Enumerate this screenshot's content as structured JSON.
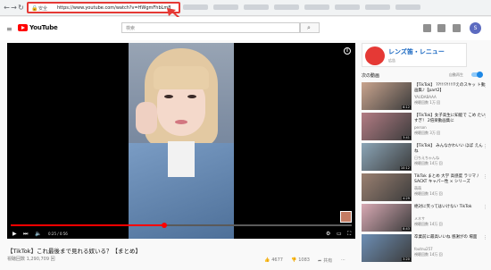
{
  "browser": {
    "secure_label": "安全",
    "url": "https://www.youtube.com/watch?v=HWgmFhbLm8",
    "colors": {
      "highlight": "#e53935"
    }
  },
  "header": {
    "brand": "YouTube",
    "search_placeholder": "検索",
    "avatar_letter": "S"
  },
  "player": {
    "time": "0:25 / 0:56",
    "progress_fraction": 0.45
  },
  "video": {
    "title": "【TikTok】これ最後まで見れる奴いる？【まとめ】",
    "views": "視聴回数 1,290,709 回",
    "likes": "4677",
    "dislikes": "1083",
    "share": "共有"
  },
  "ad": {
    "title": "レンズ笛・レニュー",
    "sub": "広告"
  },
  "sidebar": {
    "title": "次の動画",
    "autoplay_label": "自動再生",
    "items": [
      {
        "title": "【TikTok】 ??!!!?!!!!?えのスキッ ト動画集♪【part2】",
        "channel": "YAUDABAAA",
        "meta": "視聴回数 1万 回",
        "duration": "6:12",
        "thumb": "#c9a48e"
      },
      {
        "title": "【TikTok】女子高生に知能で こめ たいすぎ！ 2倍楽動画集に",
        "channel": "person",
        "meta": "視聴回数 3万 回",
        "duration": "3:41",
        "thumb": "#b37c84"
      },
      {
        "title": "【TikTok】 みんなかわいい ほぼ えんね",
        "channel": "日ちえちゃんね",
        "meta": "視聴回数 14万 回",
        "duration": "10:12",
        "thumb": "#8ba5b7"
      },
      {
        "title": "TikTok まとめ 大学 高感度 ラリマ / SACKT キャパー性 × シリーズ",
        "channel": "萌萌",
        "meta": "視聴回数 14万 回",
        "duration": "4:29",
        "thumb": "#9a8071"
      },
      {
        "title": "絶対に笑ってはいけない TikTok",
        "channel": "メネサ",
        "meta": "視聴回数 14万 回",
        "duration": "8:43",
        "thumb": "#d8a9b3"
      },
      {
        "title": "卒業前に最高いいね 感謝がの 場面",
        "channel": "foutnu257",
        "meta": "視聴回数 14万 回",
        "duration": "3:20",
        "thumb": "#6d8fb5"
      }
    ]
  }
}
